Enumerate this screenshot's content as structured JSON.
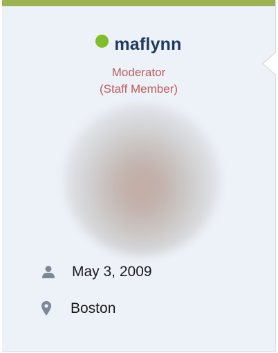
{
  "user": {
    "username": "maflynn",
    "online": true,
    "role": "Moderator",
    "role_detail": "(Staff Member)",
    "joined": "May 3, 2009",
    "location": "Boston"
  },
  "icons": {
    "online": "online-status-dot",
    "joined": "user-icon",
    "location": "map-pin-icon"
  },
  "colors": {
    "accent_bar": "#9bb350",
    "online": "#7fbe2a",
    "username": "#1f3a5c",
    "role": "#bd5b5b",
    "card_bg": "#edf2f8"
  }
}
